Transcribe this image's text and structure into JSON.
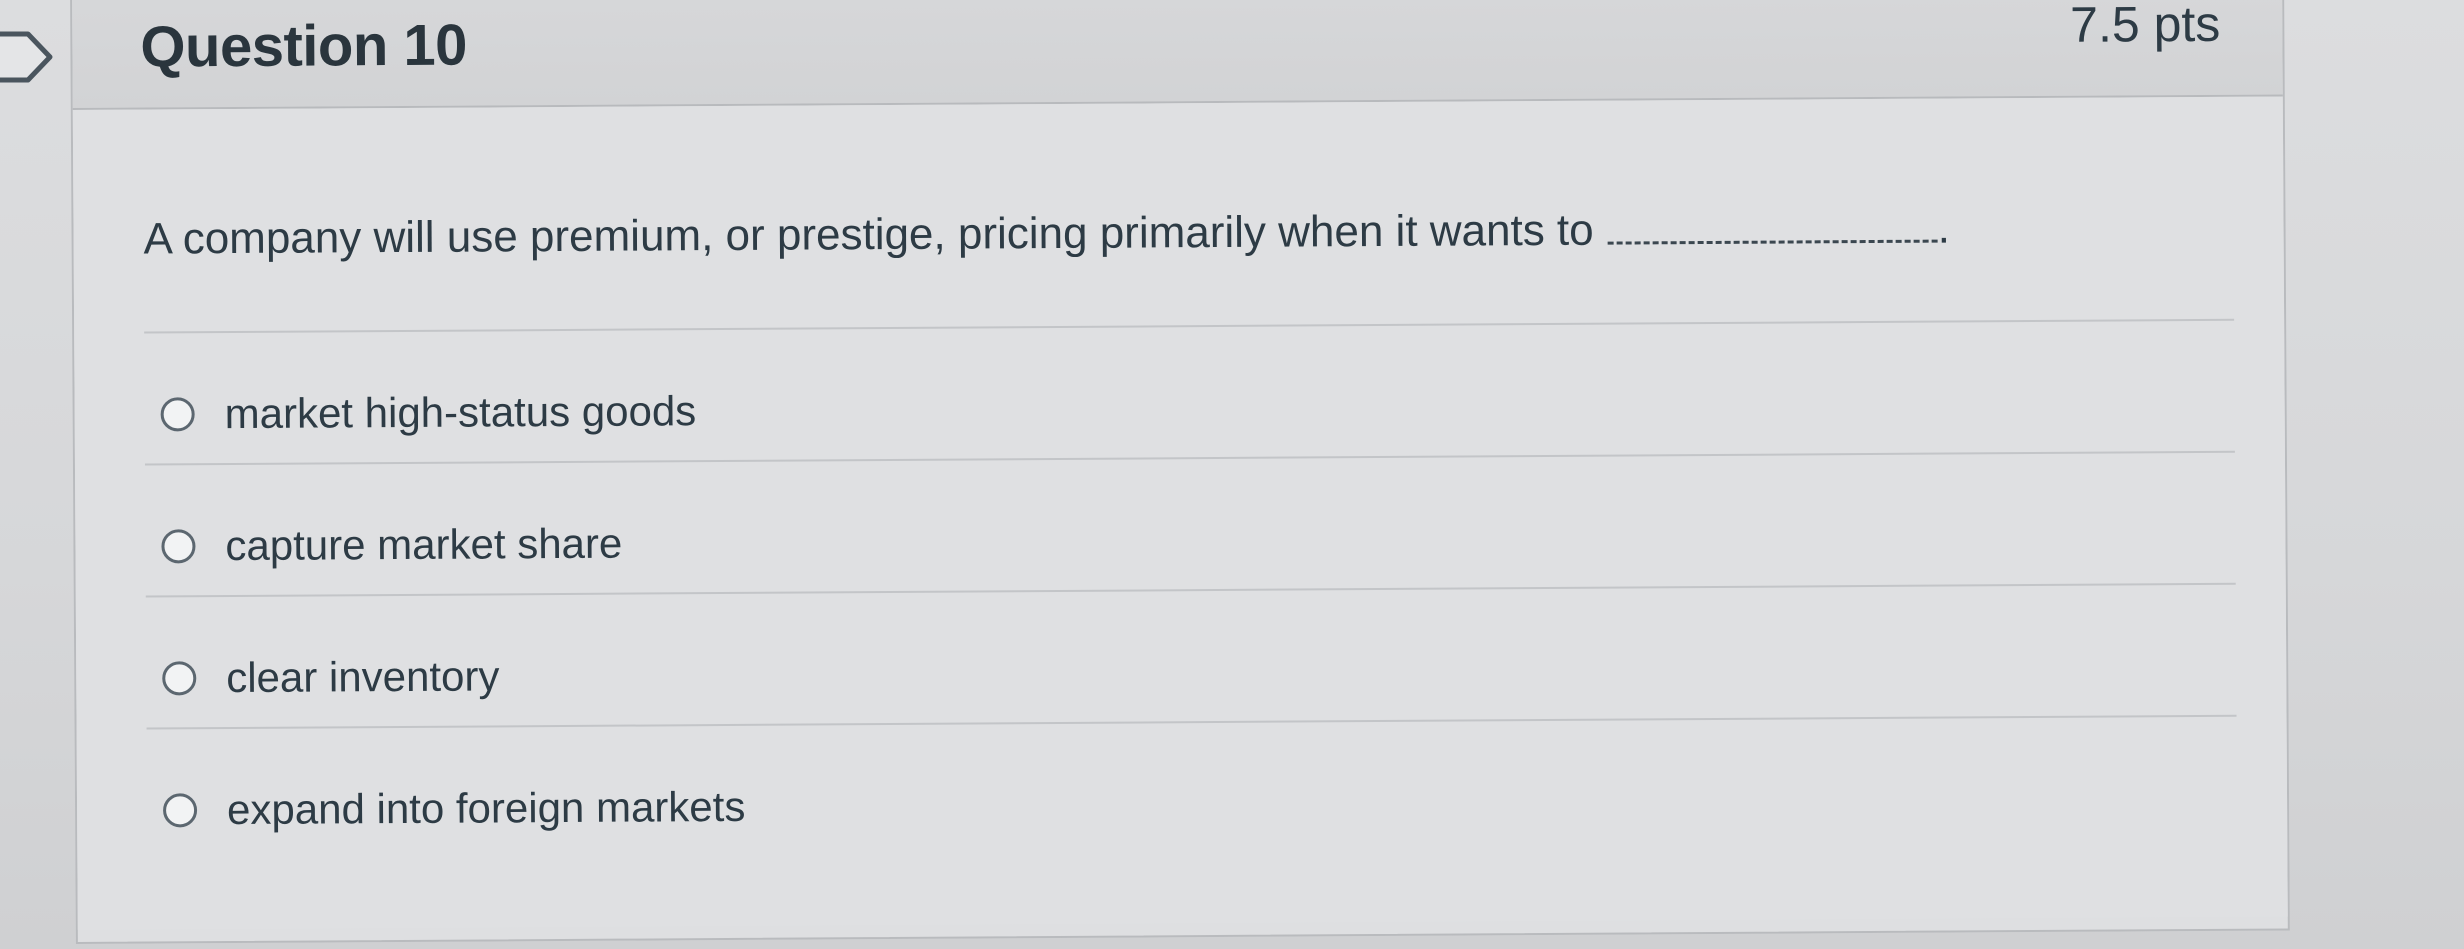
{
  "question": {
    "title": "Question 10",
    "points": "7.5 pts",
    "text": "A company will use premium, or prestige, pricing primarily when it wants to",
    "blank_suffix": "."
  },
  "answers": [
    {
      "label": "market high-status goods",
      "selected": false
    },
    {
      "label": "capture market share",
      "selected": false
    },
    {
      "label": "clear inventory",
      "selected": false
    },
    {
      "label": "expand into foreign markets",
      "selected": false
    }
  ],
  "colors": {
    "text": "#2d3b45",
    "border": "#b9bbbe",
    "background": "#dedfe1"
  },
  "icons": {
    "flag": "flag-icon"
  }
}
